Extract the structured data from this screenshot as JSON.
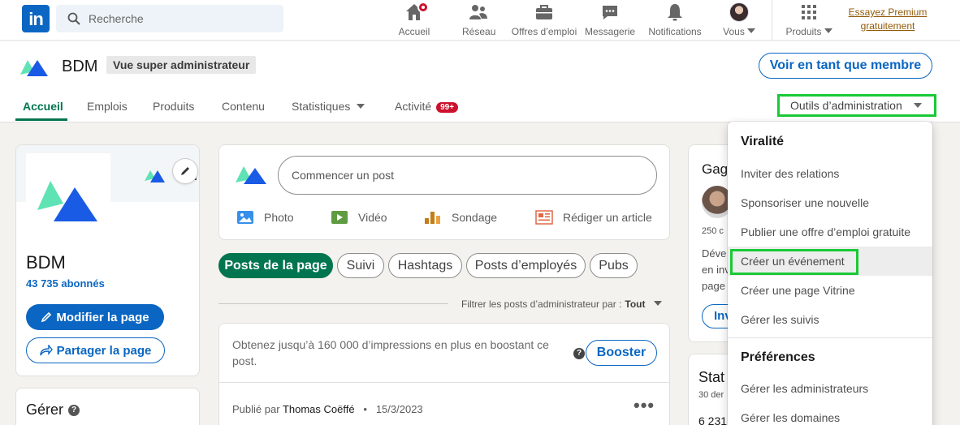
{
  "topnav": {
    "logo_text": "in",
    "search_placeholder": "Recherche",
    "items": [
      {
        "label": "Accueil",
        "icon": "home-icon"
      },
      {
        "label": "Réseau",
        "icon": "network-icon"
      },
      {
        "label": "Offres d’emploi",
        "icon": "briefcase-icon"
      },
      {
        "label": "Messagerie",
        "icon": "messaging-icon"
      },
      {
        "label": "Notifications",
        "icon": "bell-icon"
      },
      {
        "label": "Vous",
        "icon": "avatar"
      },
      {
        "label": "Produits",
        "icon": "grid-icon"
      }
    ],
    "premium_line1": "Essayez Premium",
    "premium_line2": "gratuitement"
  },
  "page_header": {
    "company": "BDM",
    "role_badge": "Vue super administrateur",
    "view_as_member": "Voir en tant que membre",
    "tabs": [
      {
        "label": "Accueil",
        "active": true
      },
      {
        "label": "Emplois"
      },
      {
        "label": "Produits"
      },
      {
        "label": "Contenu"
      },
      {
        "label": "Statistiques"
      },
      {
        "label": "Activité",
        "badge": "99+"
      }
    ],
    "admin_tools": "Outils d’administration"
  },
  "left_card": {
    "name": "BDM",
    "followers": "43 735 abonnés",
    "edit_page": "Modifier la page",
    "share_page": "Partager la page"
  },
  "manage_card": {
    "title": "Gérer"
  },
  "composer": {
    "placeholder": "Commencer un post",
    "actions": [
      {
        "label": "Photo",
        "icon": "photo-icon",
        "color": "#378fe9"
      },
      {
        "label": "Vidéo",
        "icon": "video-icon",
        "color": "#5f9b41"
      },
      {
        "label": "Sondage",
        "icon": "poll-icon",
        "color": "#c37d16"
      },
      {
        "label": "Rédiger un article",
        "icon": "article-icon",
        "color": "#e06847"
      }
    ]
  },
  "filters": {
    "pills": [
      "Posts de la page",
      "Suivi",
      "Hashtags",
      "Posts d’employés",
      "Pubs"
    ],
    "admin_filter_label": "Filtrer les posts d’administrateur par :",
    "admin_filter_value": "Tout"
  },
  "boost": {
    "text": "Obtenez jusqu’à 160 000 d’impressions en plus en boostant ce post.",
    "button": "Booster",
    "published_prefix": "Publié par",
    "author": "Thomas Coëffé",
    "separator": "•",
    "date": "15/3/2023"
  },
  "right_partial": {
    "title1": "Gag",
    "count": "250 c",
    "line1": "Déve",
    "line2": "en inv",
    "line3": "page",
    "btn": "Inv",
    "title2": "Stat",
    "line4": "30 der",
    "line5": "6 231"
  },
  "admin_menu": {
    "section1": "Viralité",
    "items1": [
      "Inviter des relations",
      "Sponsoriser une nouvelle",
      "Publier une offre d’emploi gratuite",
      "Créer un événement",
      "Créer une page Vitrine",
      "Gérer les suivis"
    ],
    "section2": "Préférences",
    "items2": [
      "Gérer les administrateurs",
      "Gérer les domaines"
    ]
  },
  "colors": {
    "brand_blue": "#0a66c2",
    "accent_green": "#01754f",
    "highlight_green": "#19c936",
    "badge_red": "#cb112d"
  }
}
